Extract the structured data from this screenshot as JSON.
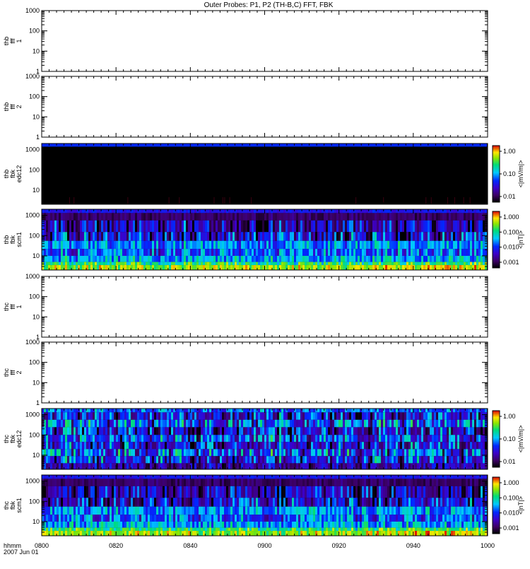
{
  "title": "Outer Probes: P1, P2 (TH-B,C) FFT, FBK",
  "time_axis": {
    "label_line1": "hhmm",
    "label_line2": "2007 Jun 01",
    "ticks": [
      "0800",
      "0820",
      "0840",
      "0900",
      "0920",
      "0940",
      "1000"
    ]
  },
  "chart_data": [
    {
      "type": "heatmap",
      "panel": "thb fff 1",
      "ylabel": [
        "thb",
        "fff",
        "1"
      ],
      "yscale": "log",
      "ylim": [
        1,
        1000
      ],
      "yticks": [
        "1000",
        "100",
        "10",
        "1"
      ],
      "data": "empty",
      "colorbar": null
    },
    {
      "type": "heatmap",
      "panel": "thb fff 2",
      "ylabel": [
        "thb",
        "fff",
        "2"
      ],
      "yscale": "log",
      "ylim": [
        1,
        1000
      ],
      "yticks": [
        "1000",
        "100",
        "10",
        "1"
      ],
      "data": "empty",
      "colorbar": null
    },
    {
      "type": "heatmap",
      "panel": "thb fbk edc12",
      "ylabel": [
        "thb",
        "fbk",
        "edc12"
      ],
      "yscale": "log",
      "ylim": [
        2,
        2000
      ],
      "yticks": [
        "1000",
        "100",
        "10"
      ],
      "pattern": "edc_b",
      "colorbar": {
        "label": "<|mV/m|>",
        "ticks": [
          "1.00",
          "0.10",
          "0.01"
        ]
      }
    },
    {
      "type": "heatmap",
      "panel": "thb fbk scm1",
      "ylabel": [
        "thb",
        "fbk",
        "scm1"
      ],
      "yscale": "log",
      "ylim": [
        2,
        2000
      ],
      "yticks": [
        "1000",
        "100",
        "10"
      ],
      "pattern": "scm",
      "colorbar": {
        "label": "<|nT|>",
        "ticks": [
          "1.000",
          "0.100",
          "0.010",
          "0.001"
        ]
      }
    },
    {
      "type": "heatmap",
      "panel": "thc fff 1",
      "ylabel": [
        "thc",
        "fff",
        "1"
      ],
      "yscale": "log",
      "ylim": [
        1,
        1000
      ],
      "yticks": [
        "1000",
        "100",
        "10",
        "1"
      ],
      "data": "empty",
      "colorbar": null
    },
    {
      "type": "heatmap",
      "panel": "thc fff 2",
      "ylabel": [
        "thc",
        "fff",
        "2"
      ],
      "yscale": "log",
      "ylim": [
        1,
        1000
      ],
      "yticks": [
        "1000",
        "100",
        "10",
        "1"
      ],
      "data": "empty",
      "colorbar": null
    },
    {
      "type": "heatmap",
      "panel": "thc fbk edc12",
      "ylabel": [
        "thc",
        "fbk",
        "edc12"
      ],
      "yscale": "log",
      "ylim": [
        2,
        2000
      ],
      "yticks": [
        "1000",
        "100",
        "10"
      ],
      "pattern": "edc_c",
      "colorbar": {
        "label": "<|mV/m|>",
        "ticks": [
          "1.00",
          "0.10",
          "0.01"
        ]
      }
    },
    {
      "type": "heatmap",
      "panel": "thc fbk scm1",
      "ylabel": [
        "thc",
        "fbk",
        "scm1"
      ],
      "yscale": "log",
      "ylim": [
        2,
        2000
      ],
      "yticks": [
        "1000",
        "100",
        "10"
      ],
      "pattern": "scm",
      "colorbar": {
        "label": "<|nT|>",
        "ticks": [
          "1.000",
          "0.100",
          "0.010",
          "0.001"
        ]
      }
    }
  ]
}
